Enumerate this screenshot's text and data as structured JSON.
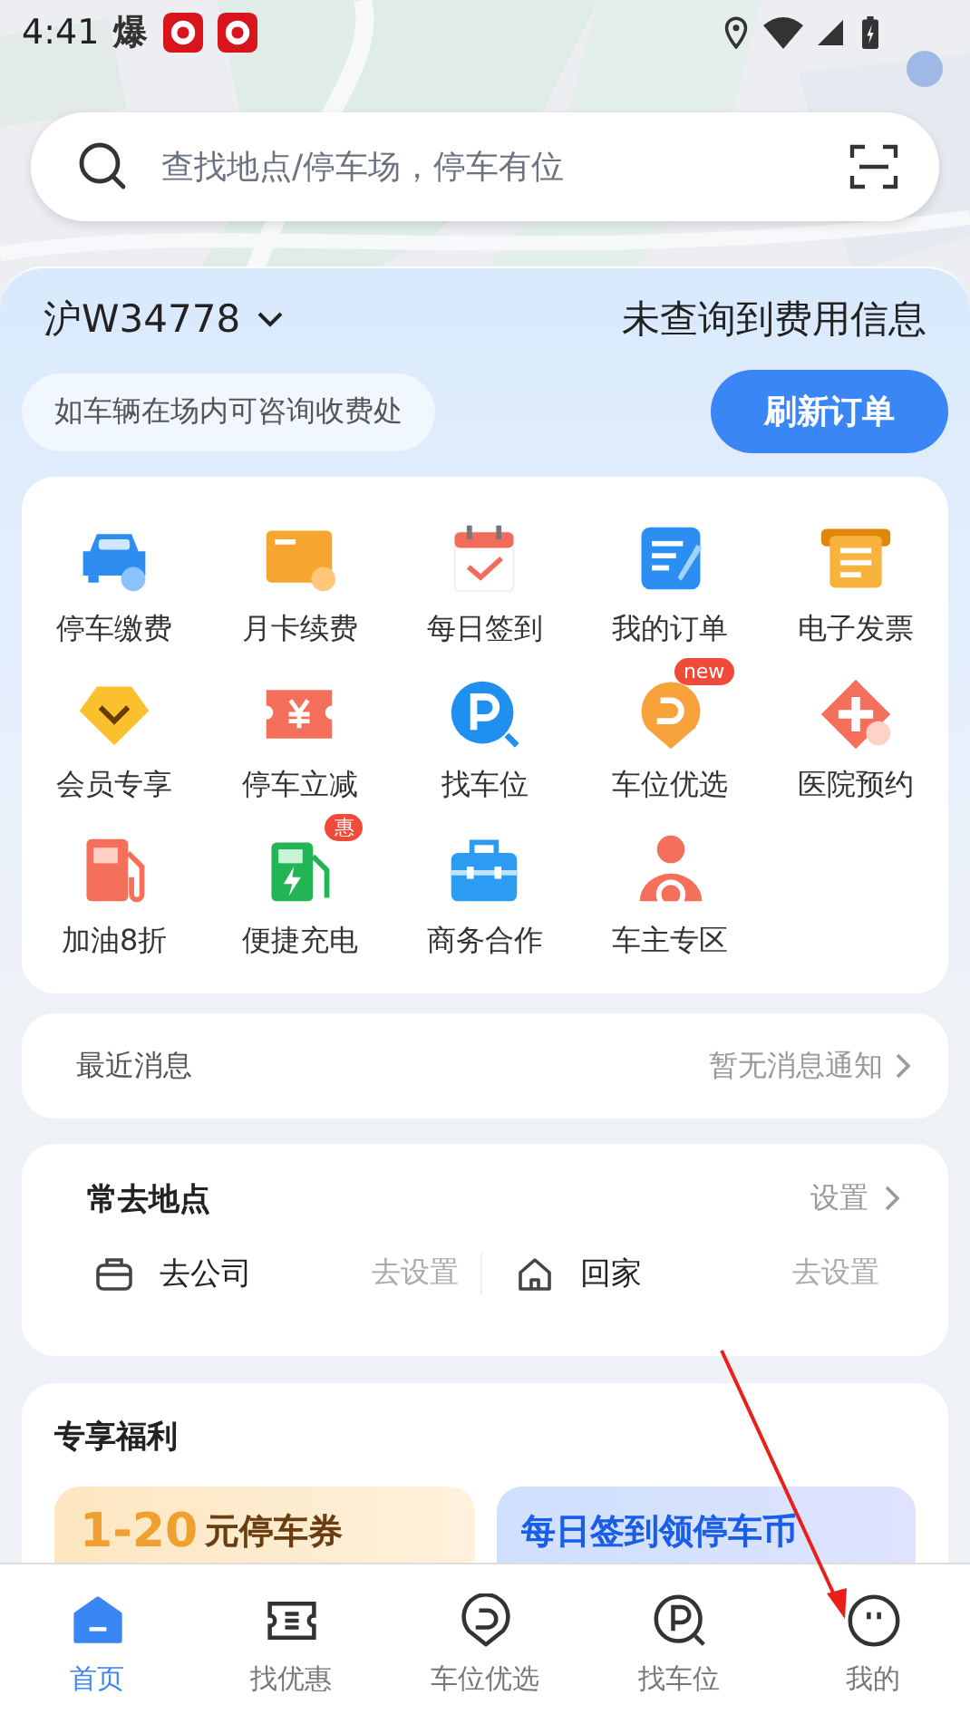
{
  "status_bar": {
    "time": "4:41",
    "glyph": "爆"
  },
  "search": {
    "placeholder": "查找地点/停车场，停车有位"
  },
  "plate": {
    "number": "沪W34778",
    "fee_status": "未查询到费用信息",
    "hint": "如车辆在场内可咨询收费处",
    "refresh_button": "刷新订单"
  },
  "services": [
    {
      "label": "停车缴费",
      "kind": "car"
    },
    {
      "label": "月卡续费",
      "kind": "card"
    },
    {
      "label": "每日签到",
      "kind": "calendar"
    },
    {
      "label": "我的订单",
      "kind": "order"
    },
    {
      "label": "电子发票",
      "kind": "invoice"
    },
    {
      "label": "会员专享",
      "kind": "vip"
    },
    {
      "label": "停车立减",
      "kind": "coupon"
    },
    {
      "label": "找车位",
      "kind": "parking"
    },
    {
      "label": "车位优选",
      "kind": "spot",
      "badge": "new"
    },
    {
      "label": "医院预约",
      "kind": "hospital"
    },
    {
      "label": "加油8折",
      "kind": "fuel"
    },
    {
      "label": "便捷充电",
      "kind": "charge",
      "badge": "惠"
    },
    {
      "label": "商务合作",
      "kind": "business"
    },
    {
      "label": "车主专区",
      "kind": "owner"
    }
  ],
  "messages": {
    "title": "最近消息",
    "status": "暂无消息通知"
  },
  "frequent_places": {
    "title": "常去地点",
    "action": "设置",
    "places": [
      {
        "kind": "work",
        "label": "去公司",
        "action": "去设置"
      },
      {
        "kind": "home",
        "label": "回家",
        "action": "去设置"
      }
    ]
  },
  "benefits": {
    "title": "专享福利",
    "promos": [
      {
        "kind": "coupon",
        "highlight": "1-20",
        "text": "元停车券"
      },
      {
        "kind": "checkin",
        "text": "每日签到领停车币"
      }
    ]
  },
  "tab_bar": [
    {
      "label": "首页",
      "kind": "home",
      "selected": true
    },
    {
      "label": "找优惠",
      "kind": "offers",
      "selected": false
    },
    {
      "label": "车位优选",
      "kind": "spot",
      "selected": false
    },
    {
      "label": "找车位",
      "kind": "parking",
      "selected": false
    },
    {
      "label": "我的",
      "kind": "mine",
      "selected": false
    }
  ]
}
